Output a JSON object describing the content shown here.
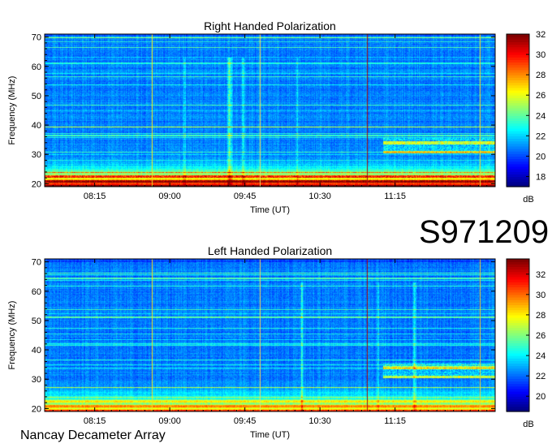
{
  "observation_id": "S971209",
  "instrument": "Nancay Decameter Array",
  "chart_data": [
    {
      "type": "heatmap",
      "title": "Right Handed Polarization",
      "xlabel": "Time (UT)",
      "ylabel": "Frequency (MHz)",
      "x_ticks": [
        "08:15",
        "09:00",
        "09:45",
        "10:30",
        "11:15"
      ],
      "x_range": [
        "07:45",
        "12:15"
      ],
      "ylim": [
        19,
        71
      ],
      "y_ticks": [
        20,
        30,
        40,
        50,
        60,
        70
      ],
      "colorbar": {
        "label": "dB",
        "min": 17,
        "max": 32,
        "ticks": [
          18,
          20,
          22,
          24,
          26,
          28,
          30,
          32
        ]
      },
      "grid": false
    },
    {
      "type": "heatmap",
      "title": "Left Handed Polarization",
      "xlabel": "Time (UT)",
      "ylabel": "Frequency (MHz)",
      "x_ticks": [
        "08:15",
        "09:00",
        "09:45",
        "10:30",
        "11:15"
      ],
      "x_range": [
        "07:45",
        "12:15"
      ],
      "ylim": [
        19,
        71
      ],
      "y_ticks": [
        20,
        30,
        40,
        50,
        60,
        70
      ],
      "colorbar": {
        "label": "dB",
        "min": 18.5,
        "max": 33.5,
        "ticks": [
          20,
          22,
          24,
          26,
          28,
          30,
          32
        ]
      },
      "grid": false
    }
  ]
}
